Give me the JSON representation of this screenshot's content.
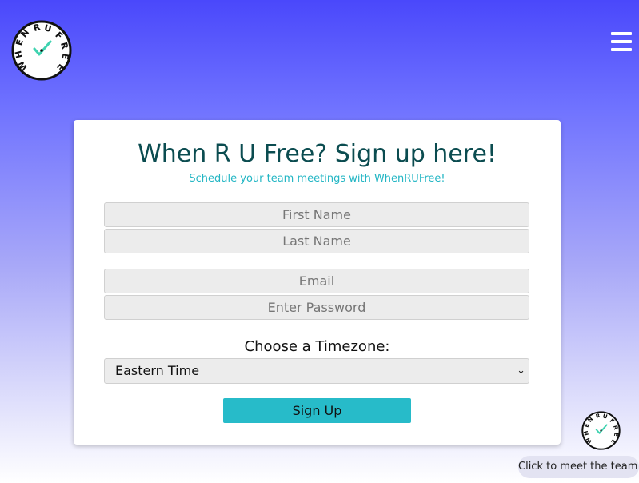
{
  "brand": {
    "logo_text": "WHEN RU FREE",
    "accent_color": "#27bbc9",
    "title_color": "#0b4c50",
    "check_color": "#3fd3b0"
  },
  "header": {
    "menu_icon": "hamburger-menu-icon"
  },
  "form": {
    "title": "When R U Free? Sign up here!",
    "subtitle": "Schedule your team meetings with WhenRUFree!",
    "first_name_placeholder": "First Name",
    "last_name_placeholder": "Last Name",
    "email_placeholder": "Email",
    "password_placeholder": "Enter Password",
    "timezone_label": "Choose a Timezone:",
    "timezone_selected": "Eastern Time",
    "submit_label": "Sign Up"
  },
  "team": {
    "tooltip": "Click to meet the team!"
  }
}
